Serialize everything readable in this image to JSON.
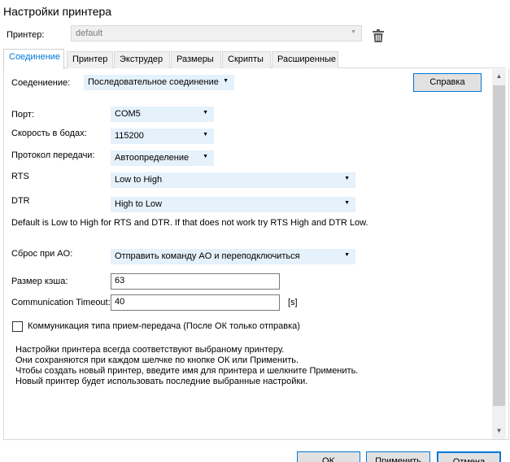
{
  "window": {
    "title": "Настройки принтера"
  },
  "printer": {
    "label": "Принтер:",
    "value": "default"
  },
  "tabs": [
    {
      "label": "Соединение",
      "active": true
    },
    {
      "label": "Принтер",
      "active": false
    },
    {
      "label": "Экструдер",
      "active": false
    },
    {
      "label": "Размеры",
      "active": false
    },
    {
      "label": "Скрипты",
      "active": false
    },
    {
      "label": "Расширенные",
      "active": false
    }
  ],
  "connection": {
    "label": "Соедениение:",
    "value": "Последовательное соединение",
    "help_button": "Справка"
  },
  "fields": {
    "port": {
      "label": "Порт:",
      "value": "COM5"
    },
    "baud": {
      "label": "Скорость в бодах:",
      "value": "115200"
    },
    "protocol": {
      "label": "Протокол передачи:",
      "value": "Автоопределение"
    },
    "rts": {
      "label": "RTS",
      "value": "Low to High"
    },
    "dtr": {
      "label": "DTR",
      "value": "High to Low"
    },
    "rts_dtr_note": "Default is Low to High for RTS and DTR. If that does not work try RTS High and DTR Low.",
    "reset": {
      "label": "Сброс при AO:",
      "value": "Отправить команду AO и переподключиться"
    },
    "cache": {
      "label": "Размер кэша:",
      "value": "63"
    },
    "timeout": {
      "label": "Communication Timeout:",
      "value": "40",
      "unit": "[s]"
    },
    "pingpong": {
      "label": "Коммуникация типа прием-передача (После ОК только отправка)",
      "checked": false
    }
  },
  "info_lines": [
    "Настройки принтера всегда соответствуют выбраному принтеру.",
    "Они сохраняются при каждом шелчке по кнопке ОК или Применить.",
    "Чтобы создать новый принтер, введите имя для принтера и шелкните Применить.",
    "Новый принтер будет использовать последние выбранные настройки."
  ],
  "footer": {
    "ok": "OK",
    "apply": "Применить",
    "cancel": "Отмена"
  }
}
